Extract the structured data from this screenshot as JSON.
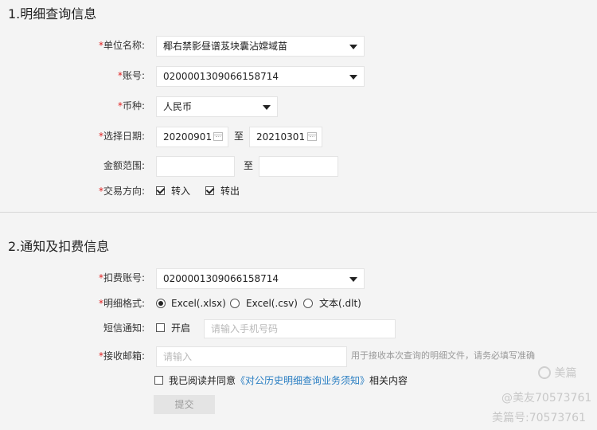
{
  "section1": {
    "title": "1.明细查询信息",
    "unit_name": {
      "label": "*单位名称:",
      "value": "椰右禁影昼谱芨块囊沾嫦域苗"
    },
    "account": {
      "label": "*账号:",
      "value": "0200001309066158714"
    },
    "currency": {
      "label": "*币种:",
      "value": "人民币"
    },
    "date": {
      "label": "*选择日期:",
      "start": "20200901",
      "separator": "至",
      "end": "20210301"
    },
    "amount": {
      "label": "金额范围:",
      "separator": "至"
    },
    "direction": {
      "label": "*交易方向:",
      "in_label": "转入",
      "in_checked": true,
      "out_label": "转出",
      "out_checked": true
    }
  },
  "section2": {
    "title": "2.通知及扣费信息",
    "fee_account": {
      "label": "*扣费账号:",
      "value": "0200001309066158714"
    },
    "format": {
      "label": "*明细格式:",
      "options": [
        "Excel(.xlsx)",
        "Excel(.csv)",
        "文本(.dlt)"
      ],
      "selected": "Excel(.xlsx)"
    },
    "sms": {
      "label": "短信通知:",
      "toggle_label": "开启",
      "checked": false,
      "placeholder": "请输入手机号码"
    },
    "email": {
      "label": "*接收邮箱:",
      "placeholder": "请输入",
      "hint": "用于接收本次查询的明细文件，请务必填写准确"
    },
    "agreement": {
      "prefix": "我已阅读并同意",
      "link": "《对公历史明细查询业务须知》",
      "suffix": "相关内容"
    },
    "submit_label": "提交"
  },
  "watermark": {
    "brand": "美篇",
    "line1": "@美友70573761",
    "line2": "美篇号:70573761"
  }
}
